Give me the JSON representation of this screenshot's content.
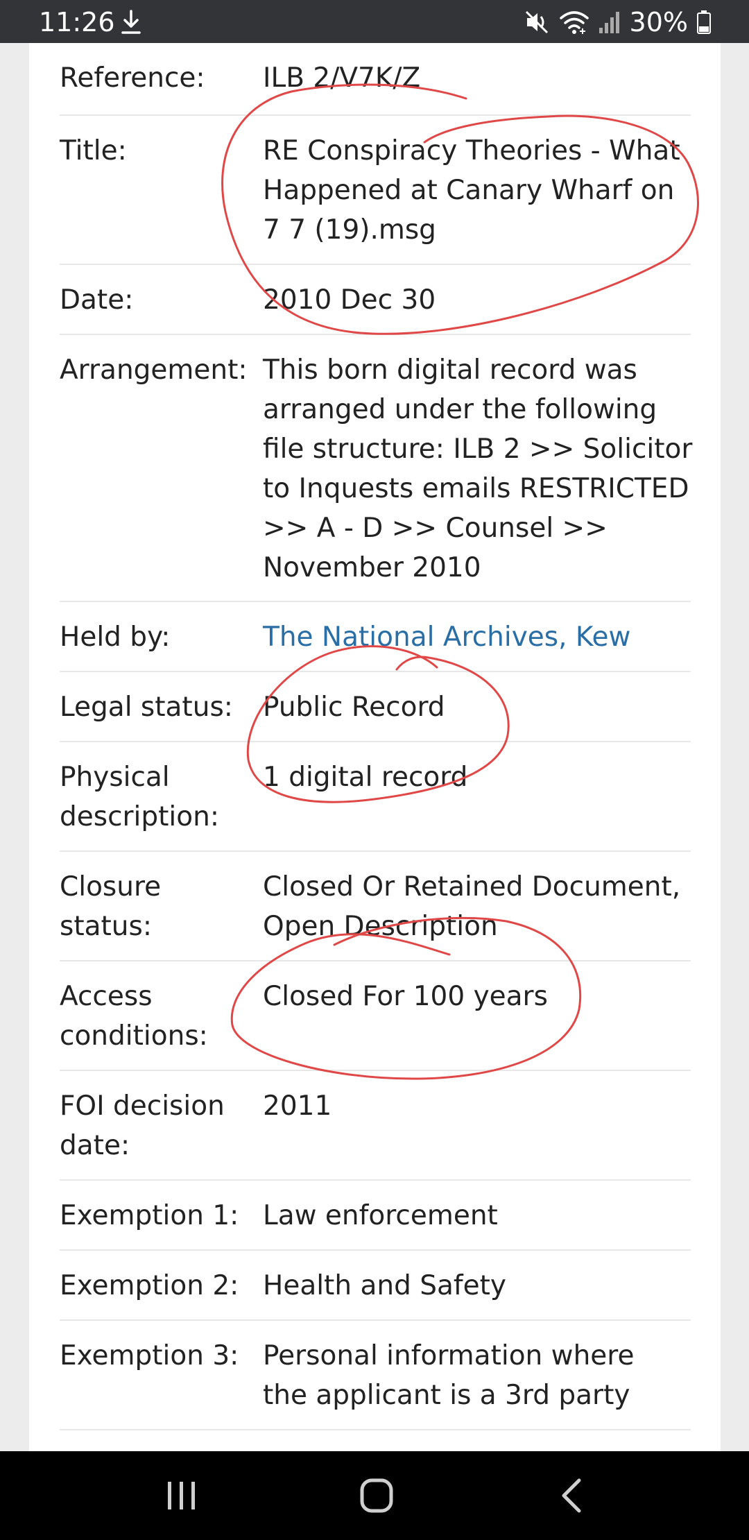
{
  "status_bar": {
    "time": "11:26",
    "battery": "30%",
    "icons": [
      "download-icon",
      "mute-icon",
      "wifi-icon",
      "signal-icon",
      "battery-icon"
    ]
  },
  "record": {
    "reference": {
      "label": "Reference:",
      "value": "ILB 2/V7K/Z"
    },
    "title": {
      "label": "Title:",
      "value_lines": [
        "RE Conspiracy Theories - What",
        "Happened at Canary Wharf on",
        "7 7 (19).msg"
      ]
    },
    "date": {
      "label": "Date:",
      "value": "2010 Dec 30"
    },
    "arrangement": {
      "label": "Arrangement:",
      "value_lines": [
        "This born digital record was",
        "arranged under the following",
        "file structure: ILB 2 >> Solicitor",
        "to Inquests emails RESTRICTED",
        ">> A - D >> Counsel >>",
        "November 2010"
      ]
    },
    "held_by": {
      "label": "Held by:",
      "value": "The National Archives, Kew"
    },
    "legal_status": {
      "label": "Legal status:",
      "value": "Public Record"
    },
    "physical_description": {
      "label_lines": [
        "Physical",
        "description:"
      ],
      "value": "1 digital record"
    },
    "closure_status": {
      "label_lines": [
        "Closure",
        "status:"
      ],
      "value_lines": [
        "Closed Or Retained Document,",
        "Open Description"
      ]
    },
    "access_conditions": {
      "label_lines": [
        "Access",
        "conditions:"
      ],
      "value": "Closed For 100 years"
    },
    "foi_decision_date": {
      "label_lines": [
        "FOI decision",
        "date:"
      ],
      "value": "2011"
    },
    "exemption_1": {
      "label": "Exemption 1:",
      "value": "Law enforcement"
    },
    "exemption_2": {
      "label": "Exemption 2:",
      "value": "Health and Safety"
    },
    "exemption_3": {
      "label": "Exemption 3:",
      "value_lines": [
        "Personal information where",
        "the applicant is a 3rd party"
      ]
    }
  },
  "annotation_color": "#e04848",
  "link_color": "#2a6ea6",
  "nav_bar": {
    "buttons": [
      "recent-apps-icon",
      "home-icon",
      "back-icon"
    ]
  }
}
